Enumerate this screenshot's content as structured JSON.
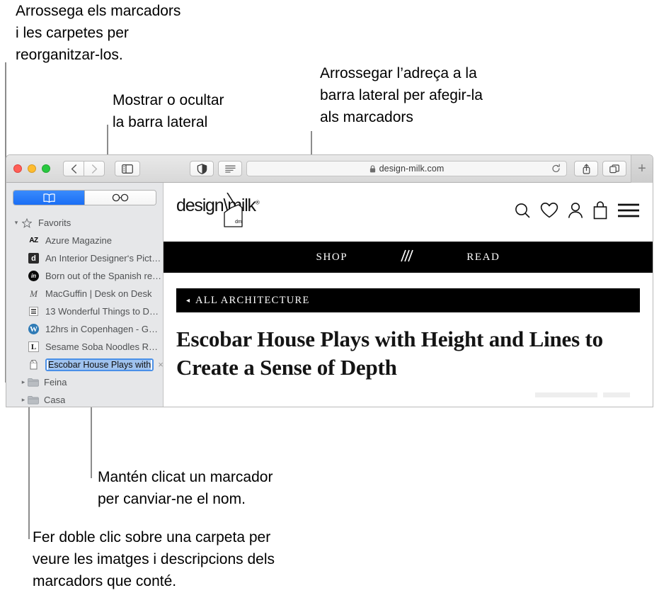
{
  "annotations": [
    {
      "id": "drag-bookmarks",
      "text": "Arrossega els marcadors\ni les carpetes per\nreorganitzar-los."
    },
    {
      "id": "show-hide-sidebar",
      "text": "Mostrar o ocultar\nla barra lateral"
    },
    {
      "id": "drag-address",
      "text": "Arrossegar l’adreça a la\nbarra lateral per afegir-la\nals marcadors"
    },
    {
      "id": "rename-bookmark",
      "text": "Mantén clicat un marcador\nper canviar-ne el nom."
    },
    {
      "id": "double-click-folder",
      "text": "Fer doble clic sobre una carpeta per\nveure les imatges i descripcions dels\nmarcadors que conté."
    }
  ],
  "browser": {
    "toolbar": {
      "back_icon": "chevron-left-icon",
      "forward_icon": "chevron-right-icon",
      "sidebar_icon": "sidebar-toggle-icon",
      "reader_icon": "reader-contrast-icon",
      "readerview_icon": "reader-lines-icon",
      "lock_icon": "lock-icon",
      "url": "design-milk.com",
      "reload_icon": "reload-icon",
      "share_icon": "share-icon",
      "tabs_icon": "show-tabs-icon",
      "newtab_label": "+"
    }
  },
  "sidebar": {
    "tabs": [
      {
        "name": "bookmarks",
        "icon": "book-icon",
        "active": true
      },
      {
        "name": "reading-list",
        "icon": "glasses-icon",
        "active": false
      }
    ],
    "groups": [
      {
        "label": "Favorits",
        "icon": "star-icon",
        "expanded": true,
        "items": [
          {
            "label": "Azure Magazine",
            "favicon": "az-favicon"
          },
          {
            "label": "An Interior Designer‘s Pict…",
            "favicon": "d-favicon"
          },
          {
            "label": "Born out of the Spanish re…",
            "favicon": "in-favicon"
          },
          {
            "label": "MacGuffin | Desk on Desk",
            "favicon": "macguffin-favicon"
          },
          {
            "label": "13 Wonderful Things to Do…",
            "favicon": "grid-favicon"
          },
          {
            "label": "12hrs in Copenhagen - Gui…",
            "favicon": "wordpress-favicon"
          },
          {
            "label": "Sesame Soba Noodles Rec…",
            "favicon": "l-favicon"
          }
        ]
      }
    ],
    "editing_item": {
      "label": "Escobar House Plays with ",
      "favicon": "milk-carton-favicon",
      "delete_label": "×"
    },
    "folders": [
      {
        "label": "Feina",
        "icon": "folder-icon"
      },
      {
        "label": "Casa",
        "icon": "folder-icon"
      }
    ]
  },
  "webpage": {
    "logo": {
      "text": "design\\milk",
      "registered": "®",
      "carton_label": "dm"
    },
    "header_icons": [
      "search-icon",
      "heart-icon",
      "account-icon",
      "shopping-bag-icon",
      "hamburger-menu-icon"
    ],
    "nav": [
      {
        "label": "SHOP"
      },
      {
        "label": "slashes-icon"
      },
      {
        "label": "READ"
      }
    ],
    "category_bar": {
      "arrow": "◂",
      "label": "ALL ARCHITECTURE"
    },
    "article_title": "Escobar House Plays with Height and Lines to Create a Sense of Depth"
  },
  "colors": {
    "accent_blue": "#2a7bf6",
    "selection_blue": "#9fc2ee",
    "black_bar": "#000000",
    "sidebar_bg": "#e6e7e9",
    "leader_gray": "#8c8c8c"
  }
}
